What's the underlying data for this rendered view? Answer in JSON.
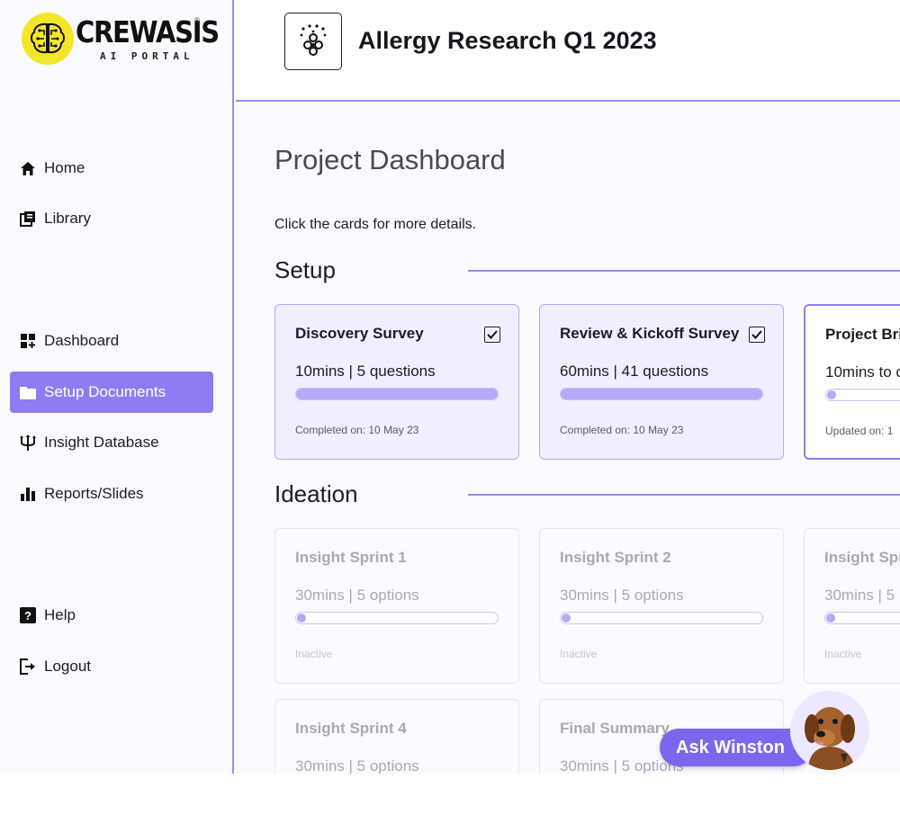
{
  "brand": {
    "name": "CREWASIS",
    "subtitle": "AI PORTAL",
    "reg": "®",
    "color": "#f3e52a"
  },
  "sidebar": {
    "items": [
      {
        "label": "Home",
        "icon": "home-icon"
      },
      {
        "label": "Library",
        "icon": "library-icon"
      },
      {
        "label": "Dashboard",
        "icon": "dashboard-icon"
      },
      {
        "label": "Setup Documents",
        "icon": "folder-icon",
        "active": true
      },
      {
        "label": "Insight Database",
        "icon": "fork-icon"
      },
      {
        "label": "Reports/Slides",
        "icon": "bar-chart-icon"
      },
      {
        "label": "Help",
        "icon": "help-icon"
      },
      {
        "label": "Logout",
        "icon": "logout-icon"
      }
    ],
    "accent": "#8f7cf2"
  },
  "header": {
    "title": "Allergy Research Q1 2023",
    "icon": "allergen-icon"
  },
  "main": {
    "title": "Project Dashboard",
    "hint": "Click the cards for more details.",
    "sections": [
      {
        "title": "Setup",
        "cards": [
          {
            "title": "Discovery Survey",
            "meta": "10mins | 5 questions",
            "status": "Completed on: 10 May 23",
            "progress": 1.0,
            "checked": true
          },
          {
            "title": "Review & Kickoff Survey",
            "meta": "60mins | 41 questions",
            "status": "Completed on: 10 May 23",
            "progress": 1.0,
            "checked": true
          },
          {
            "title": "Project Bri",
            "meta": "10mins to c",
            "status": "Updated on: 1",
            "progress": 0.0,
            "checked": false
          }
        ]
      },
      {
        "title": "Ideation",
        "cards": [
          {
            "title": "Insight Sprint 1",
            "meta": "30mins | 5 options",
            "status": "Inactive",
            "progress": 0.0
          },
          {
            "title": "Insight Sprint 2",
            "meta": "30mins | 5 options",
            "status": "Inactive",
            "progress": 0.0
          },
          {
            "title": "Insight Spr",
            "meta": "30mins | 5",
            "status": "Inactive",
            "progress": 0.0
          },
          {
            "title": "Insight Sprint 4",
            "meta": "30mins | 5 options",
            "status": "",
            "progress": 0.0
          },
          {
            "title": "Final Summary",
            "meta": "30mins | 5 options",
            "status": "",
            "progress": 0.0
          }
        ]
      }
    ]
  },
  "assistant": {
    "label": "Ask Winston",
    "avatar": "dog-avatar-icon"
  }
}
